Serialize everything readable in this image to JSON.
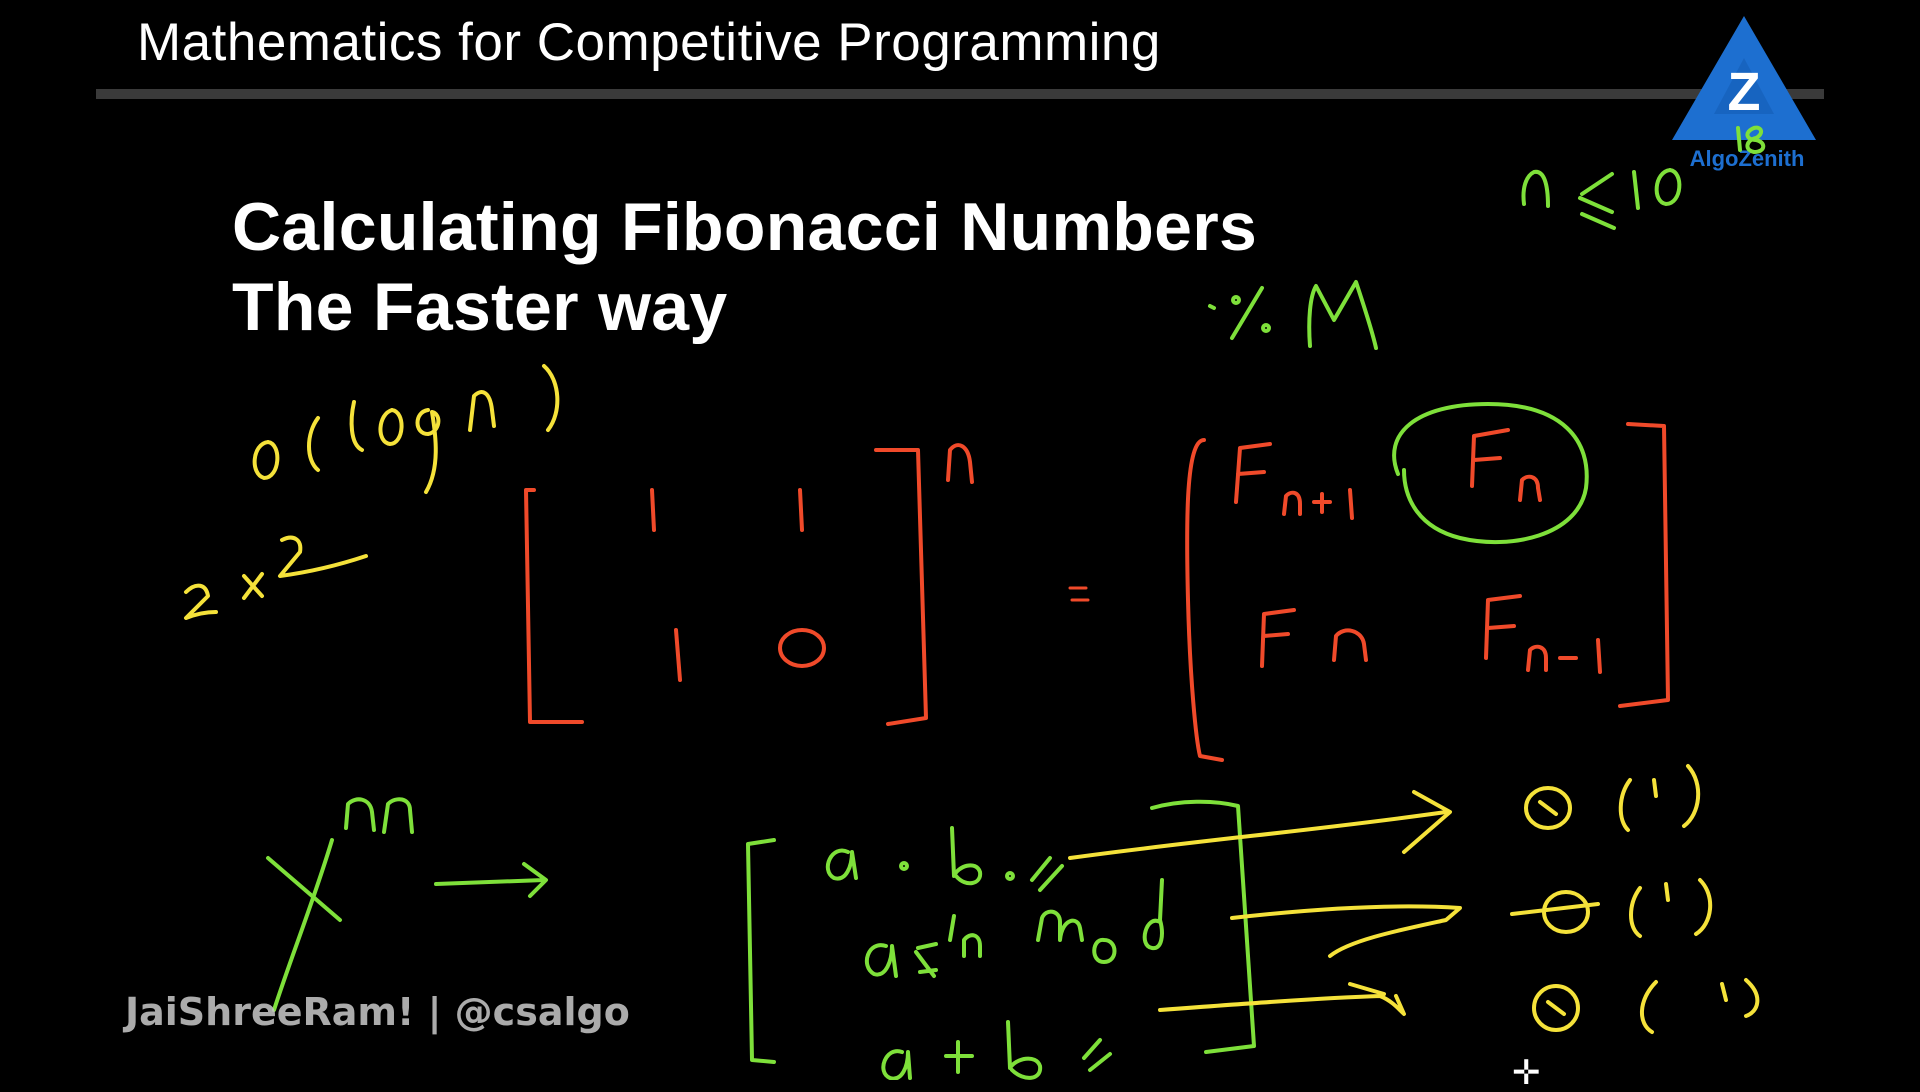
{
  "header": {
    "title": "Mathematics for Competitive Programming"
  },
  "slide": {
    "title_line_1": "Calculating Fibonacci Numbers",
    "title_line_2": "The Faster way"
  },
  "logo": {
    "letter": "Z",
    "name": "AlgoZenith"
  },
  "handwriting": {
    "constraint": "n ≤ 10^18",
    "modulus": "·%. M",
    "complexity": "O(logn)",
    "matrix_size": "2×2",
    "base_matrix": [
      "1",
      "1",
      "1",
      "0"
    ],
    "power": "n",
    "equals": "=",
    "result_matrix": [
      "Fn+1",
      "Fn",
      "Fn",
      "Fn-1"
    ],
    "power_expr": "x^n",
    "ops": [
      "a . b.",
      "a %. mod",
      "a + b"
    ],
    "ops_costs": [
      "O(1)",
      "O(1)",
      "O(1)"
    ]
  },
  "watermark": {
    "text": "JaiShreeRam! | @csalgo"
  },
  "colors": {
    "background": "#000000",
    "header_rule": "#3a3a3a",
    "ink_yellow": "#f5e23a",
    "ink_green": "#7ee03a",
    "ink_red": "#f04a2a",
    "logo_blue": "#1d6fd0"
  }
}
